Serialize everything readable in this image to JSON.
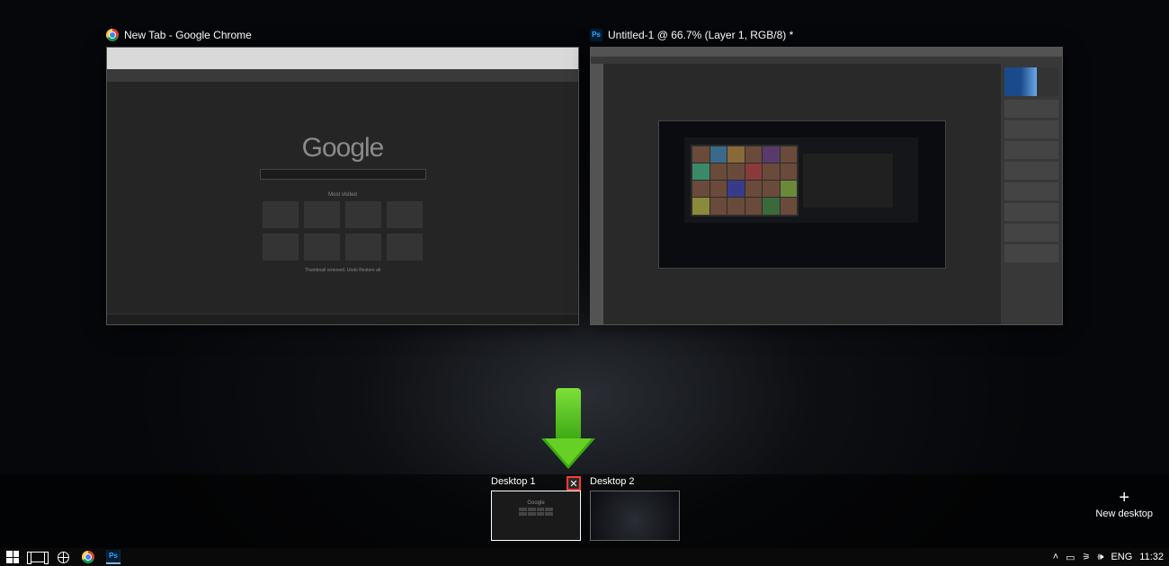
{
  "windows": {
    "chrome": {
      "title": "New Tab - Google Chrome",
      "logo_text": "Google",
      "tiles_label": "Most visited",
      "footer_text": "Thumbnail removed.   Undo   Restore all"
    },
    "photoshop": {
      "title": "Untitled-1 @ 66.7% (Layer 1, RGB/8) *",
      "icon_label": "Ps"
    }
  },
  "virtual_desktops": {
    "items": [
      {
        "label": "Desktop 1",
        "active": true
      },
      {
        "label": "Desktop 2",
        "active": false
      }
    ],
    "new_label": "New desktop"
  },
  "taskbar": {
    "tray": {
      "lang": "ENG",
      "clock": "11:32"
    }
  }
}
